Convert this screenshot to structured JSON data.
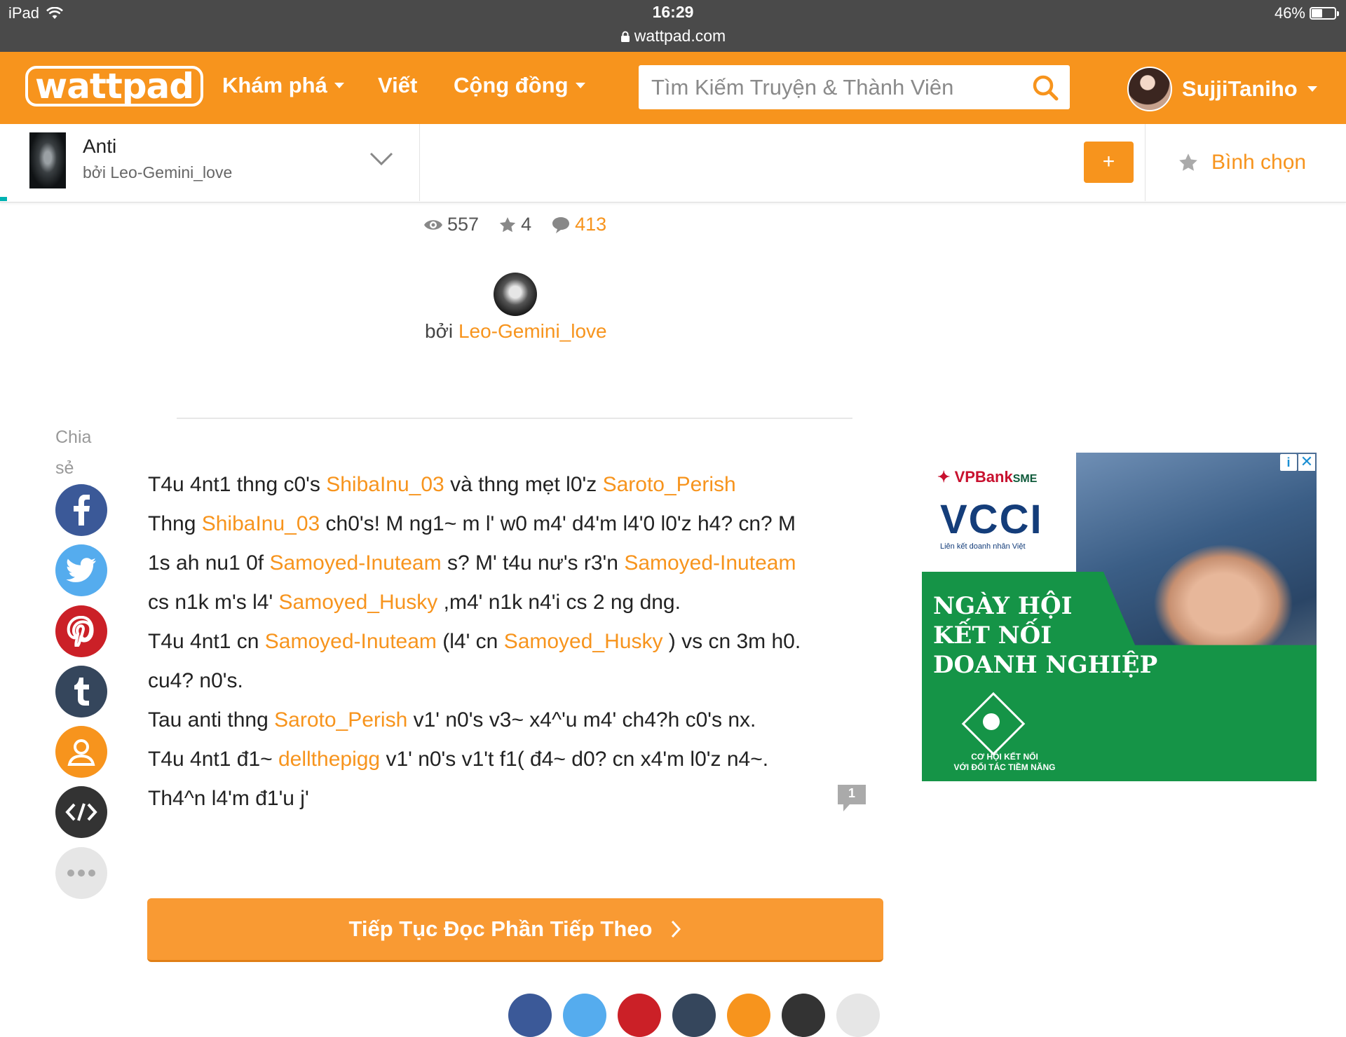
{
  "status_bar": {
    "device": "iPad",
    "time": "16:29",
    "url": "wattpad.com",
    "battery": "46%",
    "battery_level": 0.46
  },
  "navbar": {
    "logo": "wattpad",
    "discover": "Khám phá",
    "write": "Viết",
    "community": "Cộng đồng",
    "search_placeholder": "Tìm Kiếm Truyện & Thành Viên",
    "username": "SujjiTaniho"
  },
  "story_bar": {
    "title": "Anti",
    "author": "bởi Leo-Gemini_love",
    "add_label": "+",
    "vote_label": "Bình chọn"
  },
  "stats": {
    "reads": "557",
    "votes": "4",
    "comments": "413"
  },
  "byline": {
    "prefix": "bởi",
    "author": "Leo-Gemini_love"
  },
  "share": {
    "label_line1": "Chia",
    "label_line2": "sẻ",
    "buttons": [
      {
        "name": "facebook",
        "color": "#3b5998"
      },
      {
        "name": "twitter",
        "color": "#55acee"
      },
      {
        "name": "pinterest",
        "color": "#cb2027"
      },
      {
        "name": "tumblr",
        "color": "#35465c"
      },
      {
        "name": "profile",
        "color": "#f7941d"
      },
      {
        "name": "embed",
        "color": "#333333"
      },
      {
        "name": "more",
        "color": "#e6e6e6"
      }
    ]
  },
  "story": {
    "lines": [
      [
        "T4u 4nt1 thng c0's ",
        "ShibaInu_03",
        " và thng mẹt l0'z ",
        "Saroto_Perish",
        ""
      ],
      [
        "Thng ",
        "ShibaInu_03",
        " ch0's! M ng1~ m l' w0 m4' d4'm l4'0 l0'z h4? cn? M",
        "",
        ""
      ],
      [
        "1s ah nu1 0f ",
        "Samoyed-Inuteam",
        " s? M' t4u nư's r3'n ",
        "Samoyed-Inuteam",
        ""
      ],
      [
        "cs n1k m's l4' ",
        "Samoyed_Husky",
        " ,m4' n1k n4'i cs 2 ng dng.",
        "",
        ""
      ],
      [
        "T4u 4nt1 cn ",
        "Samoyed-Inuteam",
        " (l4' cn ",
        "Samoyed_Husky",
        " ) vs cn 3m h0."
      ],
      [
        "cu4? n0's.",
        "",
        "",
        "",
        ""
      ],
      [
        "Tau anti thng ",
        "Saroto_Perish",
        " v1' n0's v3~ x4^'u m4' ch4?h c0's nx.",
        "",
        ""
      ],
      [
        "T4u 4nt1 đ1~ ",
        "dellthepigg",
        " v1' n0's v1't f1( đ4~ d0? cn x4'm l0'z n4~.",
        "",
        ""
      ],
      [
        "Th4^n l4'm đ1'u j'",
        "",
        "",
        "",
        ""
      ]
    ],
    "inline_comment_count": "1"
  },
  "continue_button": "Tiếp Tục Đọc Phần Tiếp Theo",
  "ad": {
    "brand": "VPBank",
    "brand_suffix": "SME",
    "vcci": "VCCI",
    "vcci_sub": "Liên kết doanh nhân Việt",
    "headline_1": "NGÀY HỘI",
    "headline_2": "KẾT NỐI",
    "headline_3": "DOANH NGHIỆP",
    "footer_1": "CƠ HỘI KẾT NỐI",
    "footer_2": "VỚI ĐỐI TÁC TIỀM NĂNG",
    "info_label": "i",
    "close_label": "✕"
  }
}
